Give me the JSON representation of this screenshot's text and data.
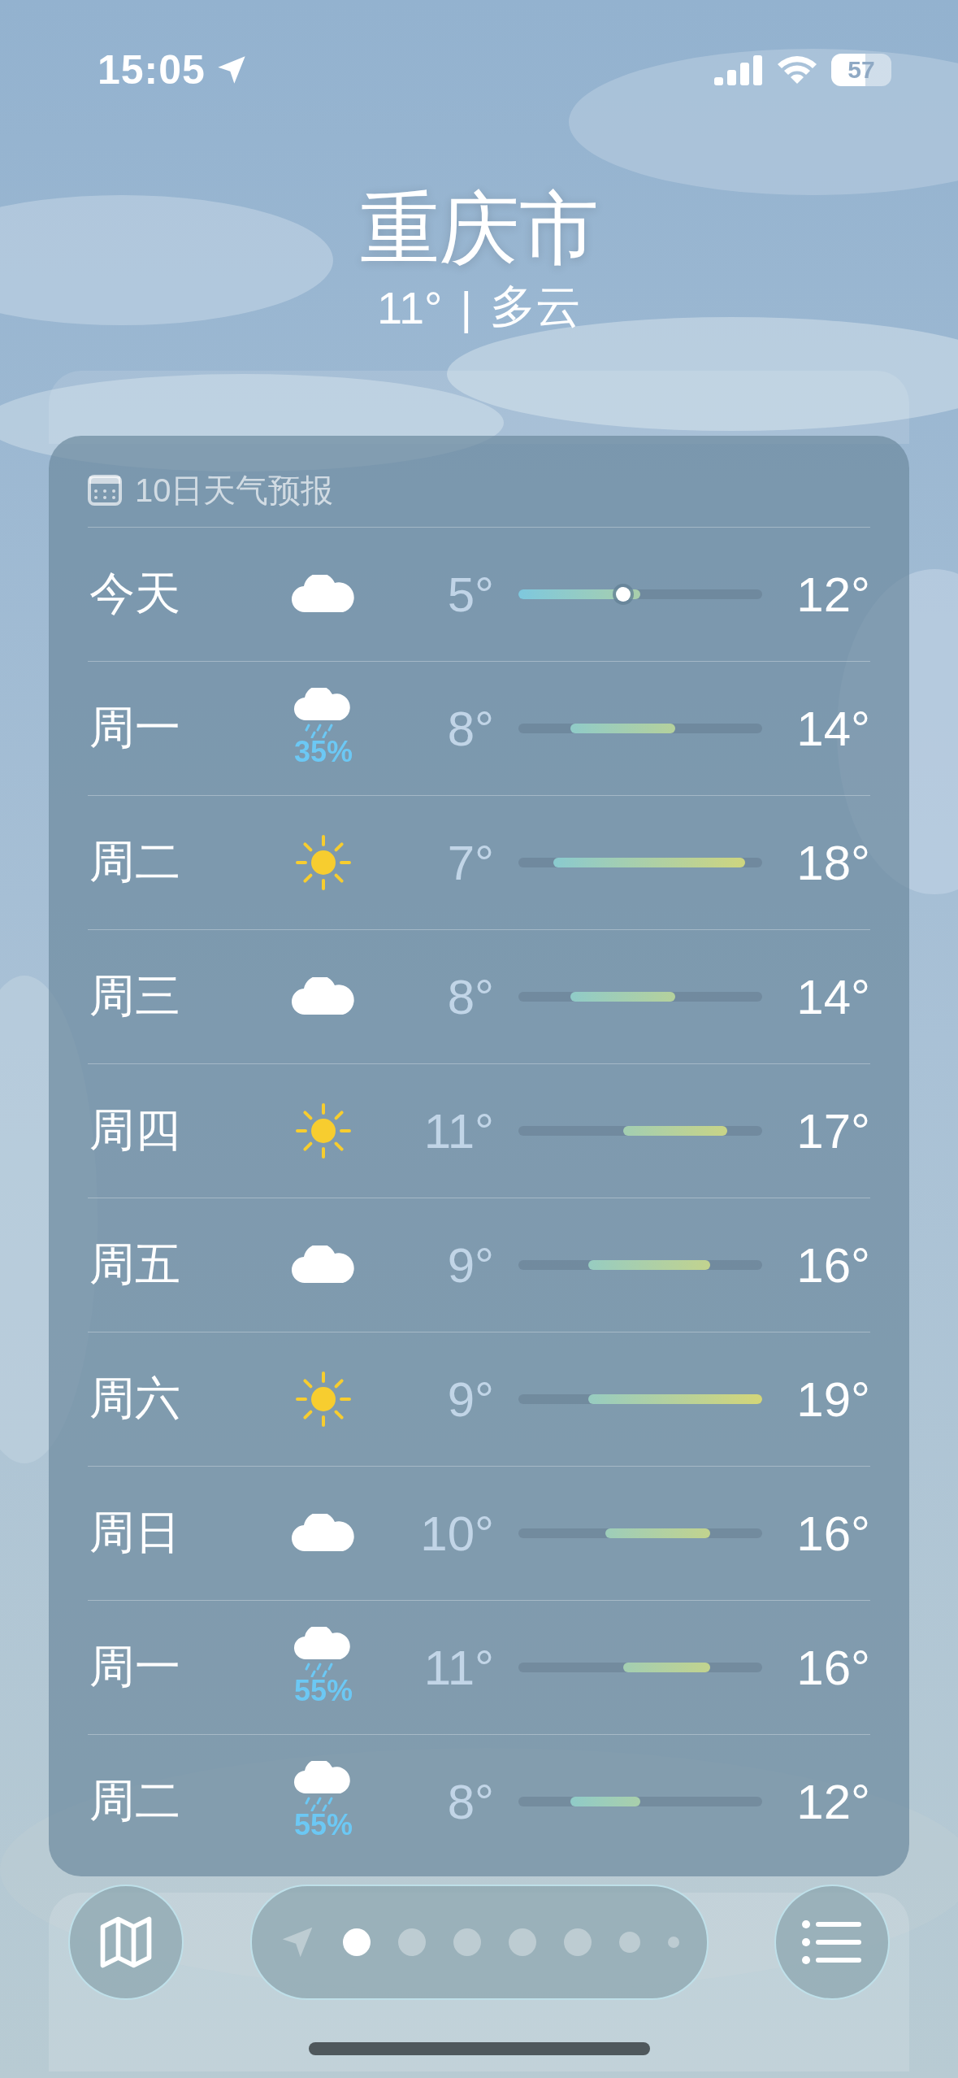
{
  "status_bar": {
    "time": "15:05",
    "battery": "57"
  },
  "header": {
    "city": "重庆市",
    "temperature": "11°",
    "separator": "|",
    "condition": "多云"
  },
  "forecast": {
    "title": "10日天气预报",
    "days": [
      {
        "day": "今天",
        "kind": "cloud",
        "low": "5°",
        "high": "12°",
        "current": true
      },
      {
        "day": "周一",
        "kind": "rain",
        "precip": "35%",
        "low": "8°",
        "high": "14°",
        "current": false
      },
      {
        "day": "周二",
        "kind": "sun",
        "low": "7°",
        "high": "18°",
        "current": false
      },
      {
        "day": "周三",
        "kind": "cloud",
        "low": "8°",
        "high": "14°",
        "current": false
      },
      {
        "day": "周四",
        "kind": "sun",
        "low": "11°",
        "high": "17°",
        "current": false
      },
      {
        "day": "周五",
        "kind": "cloud",
        "low": "9°",
        "high": "16°",
        "current": false
      },
      {
        "day": "周六",
        "kind": "sun",
        "low": "9°",
        "high": "19°",
        "current": false
      },
      {
        "day": "周日",
        "kind": "cloud",
        "low": "10°",
        "high": "16°",
        "current": false
      },
      {
        "day": "周一",
        "kind": "rain",
        "precip": "55%",
        "low": "11°",
        "high": "16°",
        "current": false
      },
      {
        "day": "周二",
        "kind": "rain",
        "precip": "55%",
        "low": "8°",
        "high": "12°",
        "current": false
      }
    ]
  },
  "pages": [
    {
      "kind": "location",
      "selected": false
    },
    {
      "kind": "dot",
      "selected": true
    },
    {
      "kind": "dot",
      "selected": false
    },
    {
      "kind": "dot",
      "selected": false
    },
    {
      "kind": "dot",
      "selected": false
    },
    {
      "kind": "dot",
      "selected": false
    },
    {
      "kind": "small",
      "selected": false
    },
    {
      "kind": "tiny",
      "selected": false
    }
  ]
}
